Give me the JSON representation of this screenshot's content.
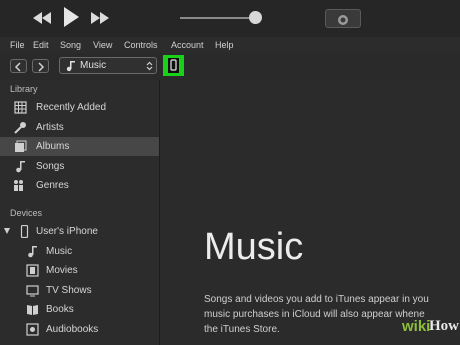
{
  "menu": [
    "File",
    "Edit",
    "Song",
    "View",
    "Controls",
    "Account",
    "Help"
  ],
  "nav": {
    "media_label": "Music"
  },
  "sidebar": {
    "library_heading": "Library",
    "library": [
      "Recently Added",
      "Artists",
      "Albums",
      "Songs",
      "Genres"
    ],
    "devices_heading": "Devices",
    "device_name": "User's iPhone",
    "device_items": [
      "Music",
      "Movies",
      "TV Shows",
      "Books",
      "Audiobooks"
    ]
  },
  "main": {
    "title": "Music",
    "desc_line1": "Songs and videos you add to iTunes appear in you",
    "desc_line2": "music purchases in iCloud will also appear whene",
    "desc_line3": "the iTunes Store."
  },
  "player": {
    "volume_level": 0.9
  },
  "watermark": {
    "part1": "wiki",
    "part2": "How"
  },
  "colors": {
    "highlight": "#19d119",
    "watermark_green": "#8bbf3c"
  },
  "icons": [
    "rewind-icon",
    "play-icon",
    "fast-forward-icon",
    "apple-logo-icon",
    "back-arrow-icon",
    "forward-arrow-icon",
    "music-note-icon",
    "device-iphone-icon"
  ]
}
